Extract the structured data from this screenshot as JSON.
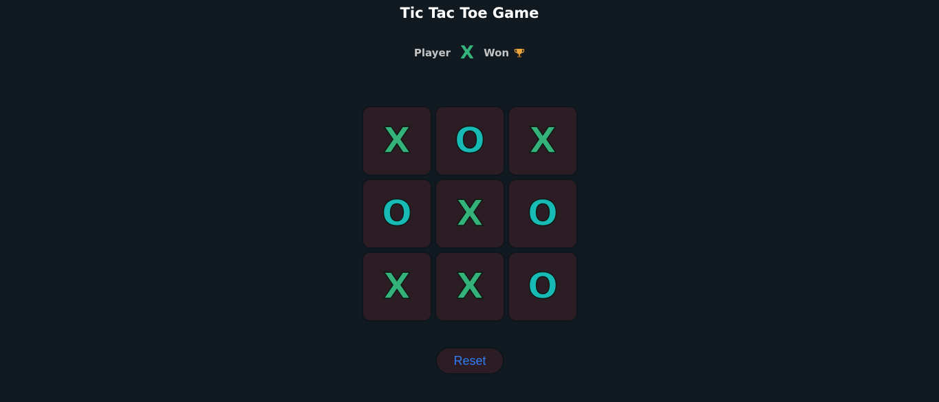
{
  "header": {
    "title": "Tic Tac Toe Game"
  },
  "status": {
    "player_label": "Player",
    "winner": "X",
    "won_label": "Won",
    "trophy_icon": "trophy-icon"
  },
  "board": {
    "cells": [
      {
        "value": "X"
      },
      {
        "value": "O"
      },
      {
        "value": "X"
      },
      {
        "value": "O"
      },
      {
        "value": "X"
      },
      {
        "value": "O"
      },
      {
        "value": "X"
      },
      {
        "value": "X"
      },
      {
        "value": "O"
      }
    ]
  },
  "controls": {
    "reset_label": "Reset"
  },
  "colors": {
    "background": "#111a21",
    "cell_background": "#2c1c23",
    "x_color": "#34b27a",
    "o_color": "#17bab5",
    "reset_text": "#2f7df6"
  }
}
